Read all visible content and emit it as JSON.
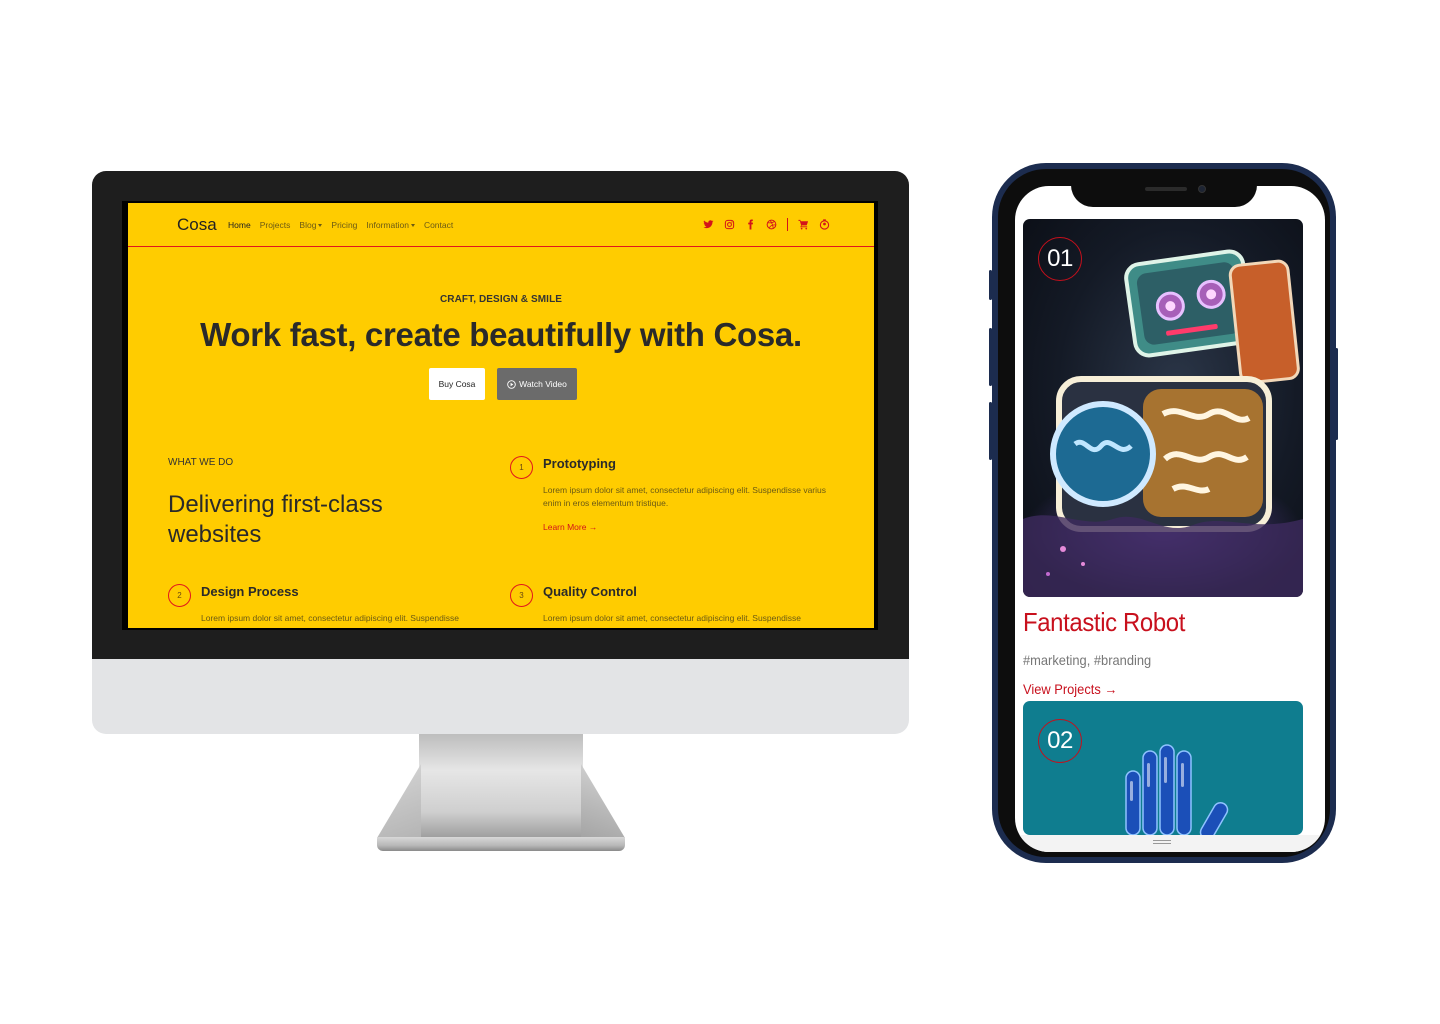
{
  "desktop": {
    "nav": {
      "brand": "Cosa",
      "links": [
        {
          "label": "Home"
        },
        {
          "label": "Projects"
        },
        {
          "label": "Blog"
        },
        {
          "label": "Pricing"
        },
        {
          "label": "Information"
        },
        {
          "label": "Contact"
        }
      ],
      "icons": [
        "twitter-icon",
        "instagram-icon",
        "facebook-icon",
        "dribbble-icon",
        "cart-icon",
        "user-icon"
      ]
    },
    "hero": {
      "eyebrow": "CRAFT, DESIGN & SMILE",
      "title": "Work fast, create beautifully with Cosa.",
      "buy_label": "Buy Cosa",
      "watch_label": "Watch Video"
    },
    "what_we_do": {
      "label": "WHAT WE DO",
      "title": "Delivering first-class websites"
    },
    "features": [
      {
        "num": "1",
        "title": "Prototyping",
        "text": "Lorem ipsum dolor sit amet, consectetur adipiscing elit. Suspendisse varius enim in eros elementum tristique.",
        "link": "Learn More →"
      },
      {
        "num": "2",
        "title": "Design Process",
        "text": "Lorem ipsum dolor sit amet, consectetur adipiscing elit. Suspendisse"
      },
      {
        "num": "3",
        "title": "Quality Control",
        "text": "Lorem ipsum dolor sit amet, consectetur adipiscing elit. Suspendisse"
      }
    ],
    "colors": {
      "background": "#ffcc00",
      "accent": "#d3131a",
      "text": "#2a2a2a"
    }
  },
  "mobile": {
    "projects": [
      {
        "num": "01",
        "title": "Fantastic Robot",
        "tags": "#marketing, #branding",
        "link": "View Projects →"
      },
      {
        "num": "02"
      }
    ],
    "colors": {
      "accent": "#c8101d",
      "muted": "#777777"
    }
  }
}
